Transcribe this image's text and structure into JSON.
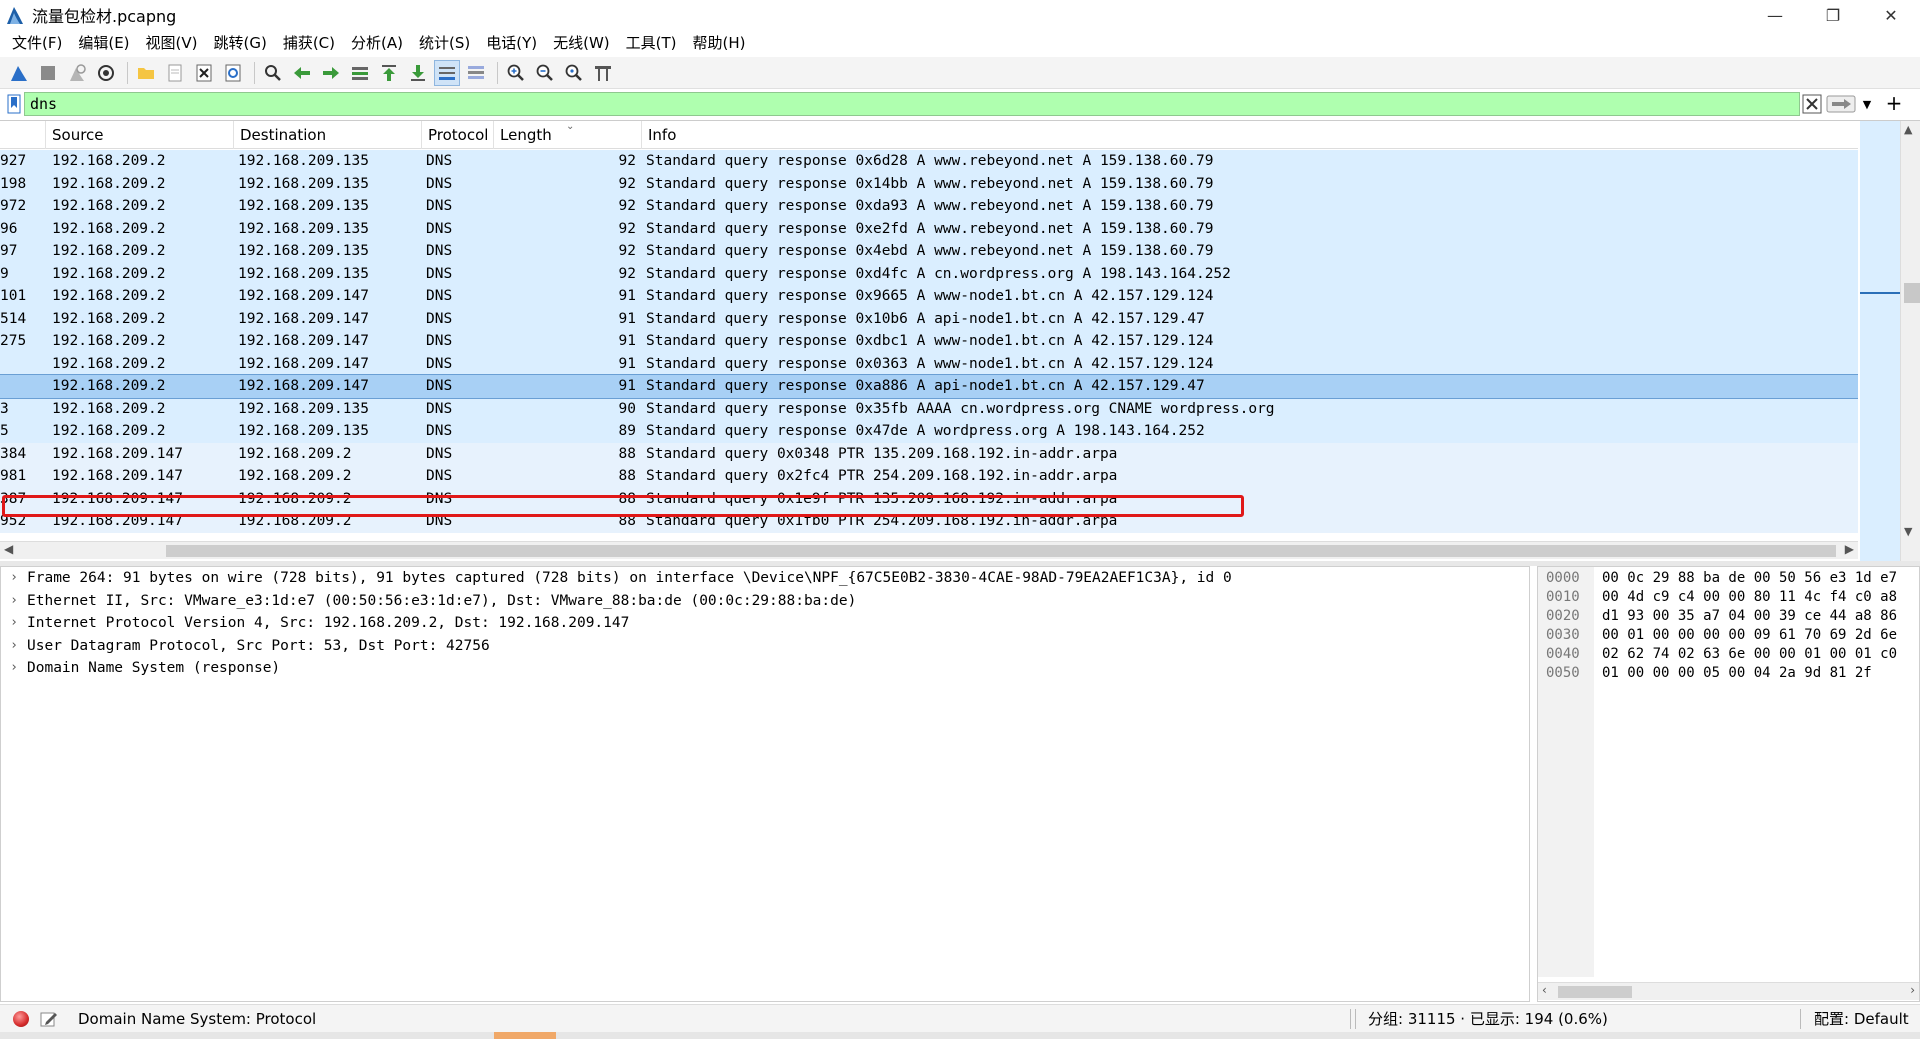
{
  "window": {
    "title": "流量包检材.pcapng",
    "minimize": "—",
    "maximize": "❐",
    "close": "✕"
  },
  "menu": [
    "文件(F)",
    "编辑(E)",
    "视图(V)",
    "跳转(G)",
    "捕获(C)",
    "分析(A)",
    "统计(S)",
    "电话(Y)",
    "无线(W)",
    "工具(T)",
    "帮助(H)"
  ],
  "filter": {
    "value": "dns"
  },
  "columns": [
    "Source",
    "Destination",
    "Protocol",
    "Length",
    "Info"
  ],
  "packets": [
    {
      "no": "927",
      "src": "192.168.209.2",
      "dst": "192.168.209.135",
      "proto": "DNS",
      "len": "92",
      "info": "Standard query response 0x6d28 A www.rebeyond.net A 159.138.60.79"
    },
    {
      "no": "198",
      "src": "192.168.209.2",
      "dst": "192.168.209.135",
      "proto": "DNS",
      "len": "92",
      "info": "Standard query response 0x14bb A www.rebeyond.net A 159.138.60.79"
    },
    {
      "no": "972",
      "src": "192.168.209.2",
      "dst": "192.168.209.135",
      "proto": "DNS",
      "len": "92",
      "info": "Standard query response 0xda93 A www.rebeyond.net A 159.138.60.79"
    },
    {
      "no": "96",
      "src": "192.168.209.2",
      "dst": "192.168.209.135",
      "proto": "DNS",
      "len": "92",
      "info": "Standard query response 0xe2fd A www.rebeyond.net A 159.138.60.79"
    },
    {
      "no": "97",
      "src": "192.168.209.2",
      "dst": "192.168.209.135",
      "proto": "DNS",
      "len": "92",
      "info": "Standard query response 0x4ebd A www.rebeyond.net A 159.138.60.79"
    },
    {
      "no": "9",
      "src": "192.168.209.2",
      "dst": "192.168.209.135",
      "proto": "DNS",
      "len": "92",
      "info": "Standard query response 0xd4fc A cn.wordpress.org A 198.143.164.252"
    },
    {
      "no": "101",
      "src": "192.168.209.2",
      "dst": "192.168.209.147",
      "proto": "DNS",
      "len": "91",
      "info": "Standard query response 0x9665 A www-node1.bt.cn A 42.157.129.124"
    },
    {
      "no": "514",
      "src": "192.168.209.2",
      "dst": "192.168.209.147",
      "proto": "DNS",
      "len": "91",
      "info": "Standard query response 0x10b6 A api-node1.bt.cn A 42.157.129.47"
    },
    {
      "no": "275",
      "src": "192.168.209.2",
      "dst": "192.168.209.147",
      "proto": "DNS",
      "len": "91",
      "info": "Standard query response 0xdbc1 A www-node1.bt.cn A 42.157.129.124"
    },
    {
      "no": "",
      "src": "192.168.209.2",
      "dst": "192.168.209.147",
      "proto": "DNS",
      "len": "91",
      "info": "Standard query response 0x0363 A www-node1.bt.cn A 42.157.129.124"
    },
    {
      "no": "",
      "src": "192.168.209.2",
      "dst": "192.168.209.147",
      "proto": "DNS",
      "len": "91",
      "info": "Standard query response 0xa886 A api-node1.bt.cn A 42.157.129.47"
    },
    {
      "no": "3",
      "src": "192.168.209.2",
      "dst": "192.168.209.135",
      "proto": "DNS",
      "len": "90",
      "info": "Standard query response 0x35fb AAAA cn.wordpress.org CNAME wordpress.org"
    },
    {
      "no": "5",
      "src": "192.168.209.2",
      "dst": "192.168.209.135",
      "proto": "DNS",
      "len": "89",
      "info": "Standard query response 0x47de A wordpress.org A 198.143.164.252"
    },
    {
      "no": "384",
      "src": "192.168.209.147",
      "dst": "192.168.209.2",
      "proto": "DNS",
      "len": "88",
      "info": "Standard query 0x0348 PTR 135.209.168.192.in-addr.arpa"
    },
    {
      "no": "981",
      "src": "192.168.209.147",
      "dst": "192.168.209.2",
      "proto": "DNS",
      "len": "88",
      "info": "Standard query 0x2fc4 PTR 254.209.168.192.in-addr.arpa"
    },
    {
      "no": "387",
      "src": "192.168.209.147",
      "dst": "192.168.209.2",
      "proto": "DNS",
      "len": "88",
      "info": "Standard query 0x1e9f PTR 135.209.168.192.in-addr.arpa"
    },
    {
      "no": "952",
      "src": "192.168.209.147",
      "dst": "192.168.209.2",
      "proto": "DNS",
      "len": "88",
      "info": "Standard query 0x1fb0 PTR 254.209.168.192.in-addr.arpa"
    }
  ],
  "selected_index": 10,
  "details": [
    "Frame 264: 91 bytes on wire (728 bits), 91 bytes captured (728 bits) on interface \\Device\\NPF_{67C5E0B2-3830-4CAE-98AD-79EA2AEF1C3A}, id 0",
    "Ethernet II, Src: VMware_e3:1d:e7 (00:50:56:e3:1d:e7), Dst: VMware_88:ba:de (00:0c:29:88:ba:de)",
    "Internet Protocol Version 4, Src: 192.168.209.2, Dst: 192.168.209.147",
    "User Datagram Protocol, Src Port: 53, Dst Port: 42756",
    "Domain Name System (response)"
  ],
  "bytes": [
    {
      "offset": "0000",
      "hex": "00 0c 29 88 ba de 00 50  56 e3 1d e7"
    },
    {
      "offset": "0010",
      "hex": "00 4d c9 c4 00 00 80 11  4c f4 c0 a8"
    },
    {
      "offset": "0020",
      "hex": "d1 93 00 35 a7 04 00 39  ce 44 a8 86"
    },
    {
      "offset": "0030",
      "hex": "00 01 00 00 00 00 09 61  70 69 2d 6e"
    },
    {
      "offset": "0040",
      "hex": "02 62 74 02 63 6e 00 00  01 00 01 c0"
    },
    {
      "offset": "0050",
      "hex": "01 00 00 00 05 00 04 2a  9d 81 2f"
    }
  ],
  "status": {
    "field": "Domain Name System: Protocol",
    "count": "分组: 31115 · 已显示: 194 (0.6%)",
    "profile": "配置: Default"
  }
}
